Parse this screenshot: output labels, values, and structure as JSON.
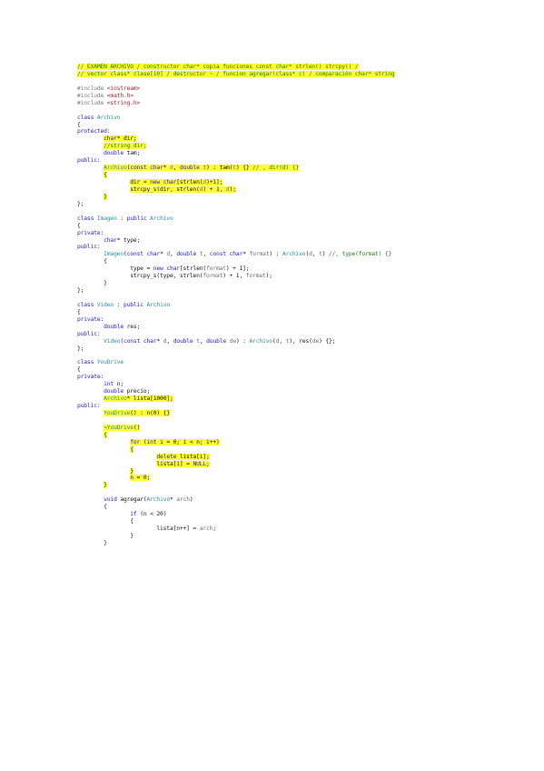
{
  "document": {
    "lines": [
      [
        [
          "hl",
          [
            [
              "cm",
              "// EXAMEN ARCHIVO / constructor char* copia funciones const char* strlen() strcpy() /"
            ]
          ]
        ]
      ],
      [
        [
          "hl",
          [
            [
              "cm",
              "// vector class* clase[10] / destructor ~ / funcion agregar(class* c) / comparación char* string"
            ]
          ]
        ]
      ],
      [],
      [
        [
          "pp",
          "#include "
        ],
        [
          "st",
          "<iostream>"
        ]
      ],
      [
        [
          "pp",
          "#include "
        ],
        [
          "st",
          "<math.h>"
        ]
      ],
      [
        [
          "pp",
          "#include "
        ],
        [
          "st",
          "<string.h>"
        ]
      ],
      [],
      [
        [
          "kw",
          "class "
        ],
        [
          "ty",
          "Archivo"
        ]
      ],
      [
        [
          "",
          "{"
        ]
      ],
      [
        [
          "kw",
          "protected"
        ],
        [
          "",
          ":"
        ]
      ],
      [
        [
          "",
          "        "
        ],
        [
          "hl",
          [
            [
              "kw",
              "char"
            ],
            [
              "",
              "* dir;"
            ]
          ]
        ]
      ],
      [
        [
          "",
          "        "
        ],
        [
          "hl",
          [
            [
              "cm",
              "//string dir;"
            ]
          ]
        ]
      ],
      [
        [
          "",
          "        "
        ],
        [
          "kw",
          "double"
        ],
        [
          "",
          " tam;"
        ]
      ],
      [
        [
          "kw",
          "public"
        ],
        [
          "",
          ":"
        ]
      ],
      [
        [
          "",
          "        "
        ],
        [
          "hl",
          [
            [
              "ty",
              "Archivo"
            ],
            [
              "",
              "("
            ],
            [
              "kw",
              "const char"
            ],
            [
              "",
              "* "
            ],
            [
              "pa",
              "d"
            ],
            [
              "",
              ", "
            ],
            [
              "kw",
              "double"
            ],
            [
              "",
              " "
            ],
            [
              "pa",
              "t"
            ],
            [
              "",
              ") : tam("
            ],
            [
              "pa",
              "t"
            ],
            [
              "",
              ") {} "
            ],
            [
              "cm",
              "// , dir(d) {}"
            ]
          ]
        ]
      ],
      [
        [
          "",
          "        "
        ],
        [
          "hl",
          [
            [
              "",
              "{"
            ]
          ]
        ]
      ],
      [
        [
          "",
          "                "
        ],
        [
          "hl",
          [
            [
              "",
              "dir = "
            ],
            [
              "kw",
              "new char"
            ],
            [
              "",
              "[strlen("
            ],
            [
              "pa",
              "d"
            ],
            [
              "",
              ")+1];"
            ]
          ]
        ]
      ],
      [
        [
          "",
          "                "
        ],
        [
          "hl",
          [
            [
              "",
              "strcpy_s(dir, strlen("
            ],
            [
              "pa",
              "d"
            ],
            [
              "",
              ") + 1, "
            ],
            [
              "pa",
              "d"
            ],
            [
              "",
              ");"
            ]
          ]
        ]
      ],
      [
        [
          "",
          "        "
        ],
        [
          "hl",
          [
            [
              "",
              "}"
            ]
          ]
        ]
      ],
      [
        [
          "",
          "};"
        ]
      ],
      [],
      [
        [
          "kw",
          "class "
        ],
        [
          "ty",
          "Imagen"
        ],
        [
          "",
          " : "
        ],
        [
          "kw",
          "public "
        ],
        [
          "ty",
          "Archivo"
        ]
      ],
      [
        [
          "",
          "{"
        ]
      ],
      [
        [
          "kw",
          "private"
        ],
        [
          "",
          ":"
        ]
      ],
      [
        [
          "",
          "        "
        ],
        [
          "kw",
          "char"
        ],
        [
          "",
          "* type;"
        ]
      ],
      [
        [
          "kw",
          "public"
        ],
        [
          "",
          ":"
        ]
      ],
      [
        [
          "",
          "        "
        ],
        [
          "ty",
          "Imagen"
        ],
        [
          "",
          "("
        ],
        [
          "kw",
          "const char"
        ],
        [
          "",
          "* "
        ],
        [
          "pa",
          "d"
        ],
        [
          "",
          ", "
        ],
        [
          "kw",
          "double"
        ],
        [
          "",
          " "
        ],
        [
          "pa",
          "t"
        ],
        [
          "",
          ", "
        ],
        [
          "kw",
          "const char"
        ],
        [
          "",
          "* "
        ],
        [
          "pa",
          "format"
        ],
        [
          "",
          ") : "
        ],
        [
          "ty",
          "Archivo"
        ],
        [
          "",
          "("
        ],
        [
          "pa",
          "d"
        ],
        [
          "",
          ", "
        ],
        [
          "pa",
          "t"
        ],
        [
          "",
          ") "
        ],
        [
          "cm",
          "//, type(format) {}"
        ]
      ],
      [
        [
          "",
          "        {"
        ]
      ],
      [
        [
          "",
          "                type = "
        ],
        [
          "kw",
          "new char"
        ],
        [
          "",
          "[strlen("
        ],
        [
          "pa",
          "format"
        ],
        [
          "",
          ") + 1];"
        ]
      ],
      [
        [
          "",
          "                strcpy_s(type, strlen("
        ],
        [
          "pa",
          "format"
        ],
        [
          "",
          ") + 1, "
        ],
        [
          "pa",
          "format"
        ],
        [
          "",
          ");"
        ]
      ],
      [
        [
          "",
          "        }"
        ]
      ],
      [
        [
          "",
          "};"
        ]
      ],
      [],
      [
        [
          "kw",
          "class "
        ],
        [
          "ty",
          "Video"
        ],
        [
          "",
          " : "
        ],
        [
          "kw",
          "public "
        ],
        [
          "ty",
          "Archivo"
        ]
      ],
      [
        [
          "",
          "{"
        ]
      ],
      [
        [
          "kw",
          "private"
        ],
        [
          "",
          ":"
        ]
      ],
      [
        [
          "",
          "        "
        ],
        [
          "kw",
          "double"
        ],
        [
          "",
          " res;"
        ]
      ],
      [
        [
          "kw",
          "public"
        ],
        [
          "",
          ":"
        ]
      ],
      [
        [
          "",
          "        "
        ],
        [
          "ty",
          "Video"
        ],
        [
          "",
          "("
        ],
        [
          "kw",
          "const char"
        ],
        [
          "",
          "* "
        ],
        [
          "pa",
          "d"
        ],
        [
          "",
          ", "
        ],
        [
          "kw",
          "double"
        ],
        [
          "",
          " "
        ],
        [
          "pa",
          "t"
        ],
        [
          "",
          ", "
        ],
        [
          "kw",
          "double"
        ],
        [
          "",
          " "
        ],
        [
          "pa",
          "de"
        ],
        [
          "",
          ") : "
        ],
        [
          "ty",
          "Archivo"
        ],
        [
          "",
          "("
        ],
        [
          "pa",
          "d"
        ],
        [
          "",
          ", "
        ],
        [
          "pa",
          "t"
        ],
        [
          "",
          "), res("
        ],
        [
          "pa",
          "de"
        ],
        [
          "",
          ") {};"
        ]
      ],
      [
        [
          "",
          "};"
        ]
      ],
      [],
      [
        [
          "kw",
          "class "
        ],
        [
          "ty",
          "YouDrive"
        ]
      ],
      [
        [
          "",
          "{"
        ]
      ],
      [
        [
          "kw",
          "private"
        ],
        [
          "",
          ":"
        ]
      ],
      [
        [
          "",
          "        "
        ],
        [
          "kw",
          "int"
        ],
        [
          "",
          " n;"
        ]
      ],
      [
        [
          "",
          "        "
        ],
        [
          "kw",
          "double"
        ],
        [
          "",
          " precio;"
        ]
      ],
      [
        [
          "",
          "        "
        ],
        [
          "hl",
          [
            [
              "ty",
              "Archivo"
            ],
            [
              "",
              "* lista[1000];"
            ]
          ]
        ]
      ],
      [
        [
          "kw",
          "public"
        ],
        [
          "",
          ":"
        ]
      ],
      [
        [
          "",
          "        "
        ],
        [
          "hl",
          [
            [
              "ty",
              "YouDrive"
            ],
            [
              "",
              "() : n(0) {}"
            ]
          ]
        ]
      ],
      [],
      [
        [
          "",
          "        "
        ],
        [
          "hl",
          [
            [
              "",
              "~"
            ],
            [
              "ty",
              "YouDrive"
            ],
            [
              "",
              "()"
            ]
          ]
        ]
      ],
      [
        [
          "",
          "        "
        ],
        [
          "hl",
          [
            [
              "",
              "{"
            ]
          ]
        ]
      ],
      [
        [
          "",
          "                "
        ],
        [
          "hl",
          [
            [
              "kw",
              "for"
            ],
            [
              "",
              " ("
            ],
            [
              "kw",
              "int"
            ],
            [
              "",
              " i = 0; i < n; i++)"
            ]
          ]
        ]
      ],
      [
        [
          "",
          "                "
        ],
        [
          "hl",
          [
            [
              "",
              "{"
            ]
          ]
        ]
      ],
      [
        [
          "",
          "                        "
        ],
        [
          "hl",
          [
            [
              "kw",
              "delete"
            ],
            [
              "",
              " lista[i];"
            ]
          ]
        ]
      ],
      [
        [
          "",
          "                        "
        ],
        [
          "hl",
          [
            [
              "",
              "lista[i] = "
            ],
            [
              "kw",
              "NULL"
            ],
            [
              "",
              ";"
            ]
          ]
        ]
      ],
      [
        [
          "",
          "                "
        ],
        [
          "hl",
          [
            [
              "",
              "}"
            ]
          ]
        ]
      ],
      [
        [
          "",
          "                "
        ],
        [
          "hl",
          [
            [
              "",
              "n = 0;"
            ]
          ]
        ]
      ],
      [
        [
          "",
          "        "
        ],
        [
          "hl",
          [
            [
              "",
              "}"
            ]
          ]
        ]
      ],
      [],
      [
        [
          "",
          "        "
        ],
        [
          "kw",
          "void"
        ],
        [
          "",
          " agregar("
        ],
        [
          "ty",
          "Archivo"
        ],
        [
          "",
          "* "
        ],
        [
          "pa",
          "arch"
        ],
        [
          "",
          ")"
        ]
      ],
      [
        [
          "",
          "        {"
        ]
      ],
      [
        [
          "",
          "                "
        ],
        [
          "kw",
          "if"
        ],
        [
          "",
          " (n < 20)"
        ]
      ],
      [
        [
          "",
          "                {"
        ]
      ],
      [
        [
          "",
          "                        lista[n++] = "
        ],
        [
          "pa",
          "arch"
        ],
        [
          "",
          ";"
        ]
      ],
      [
        [
          "",
          "                }"
        ]
      ],
      [
        [
          "",
          "        }"
        ]
      ]
    ]
  }
}
